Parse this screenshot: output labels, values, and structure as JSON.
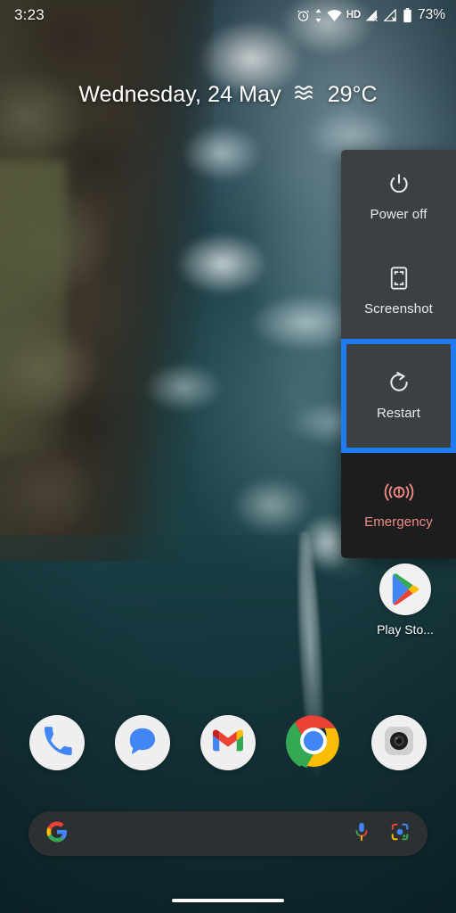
{
  "status_bar": {
    "time": "3:23",
    "battery_percent": "73%",
    "hd_label": "HD",
    "icons": [
      "alarm-icon",
      "data-transfer-icon",
      "wifi-icon",
      "hd-icon",
      "signal-no-sim-1-icon",
      "signal-no-sim-2-icon",
      "battery-icon"
    ]
  },
  "date_widget": {
    "date": "Wednesday, 24 May",
    "weather_icon": "haze-waves-icon",
    "temperature": "29°C"
  },
  "power_menu": {
    "accent_focus_color": "#1f7bf0",
    "panel_color": "#3c4043",
    "emergency_color": "#f28b82",
    "items": [
      {
        "label": "Power off",
        "icon": "power-off-icon",
        "focused": false
      },
      {
        "label": "Screenshot",
        "icon": "screenshot-icon",
        "focused": false
      },
      {
        "label": "Restart",
        "icon": "restart-icon",
        "focused": true
      },
      {
        "label": "Emergency",
        "icon": "emergency-icon",
        "focused": false
      }
    ]
  },
  "home_screen": {
    "app": {
      "label": "Play Sto...",
      "icon": "play-store-icon"
    }
  },
  "dock": {
    "items": [
      {
        "label": "Phone",
        "icon": "phone-icon"
      },
      {
        "label": "Messages",
        "icon": "messages-icon"
      },
      {
        "label": "Gmail",
        "icon": "gmail-icon"
      },
      {
        "label": "Chrome",
        "icon": "chrome-icon"
      },
      {
        "label": "Camera",
        "icon": "camera-icon"
      }
    ]
  },
  "search": {
    "placeholder": "",
    "value": "",
    "logo_icon": "google-g-icon",
    "mic_icon": "microphone-icon",
    "lens_icon": "google-lens-icon"
  },
  "navigation": {
    "pill": "gesture-nav-pill"
  }
}
